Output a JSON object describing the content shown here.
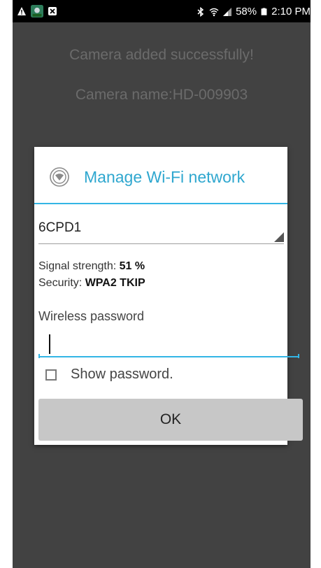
{
  "status_bar": {
    "left_icons": [
      "warning-icon",
      "app-icon",
      "close-box-icon"
    ],
    "right_icons": [
      "bluetooth-icon",
      "wifi-icon",
      "signal-icon",
      "battery-icon"
    ],
    "battery": "58%",
    "time": "2:10 PM"
  },
  "background": {
    "success_message": "Camera added successfully!",
    "camera_name": "Camera name:HD-009903"
  },
  "dialog": {
    "title": "Manage Wi-Fi network",
    "icon": "wifi-circle-icon",
    "accent_color": "#33b5e5",
    "network_selected": "6CPD1",
    "signal_label": "Signal strength: ",
    "signal_value": "51 %",
    "security_label": "Security: ",
    "security_value": "WPA2 TKIP",
    "password_label": "Wireless password",
    "password_value": "",
    "show_password_label": "Show password.",
    "show_password_checked": false,
    "ok_label": "OK"
  }
}
